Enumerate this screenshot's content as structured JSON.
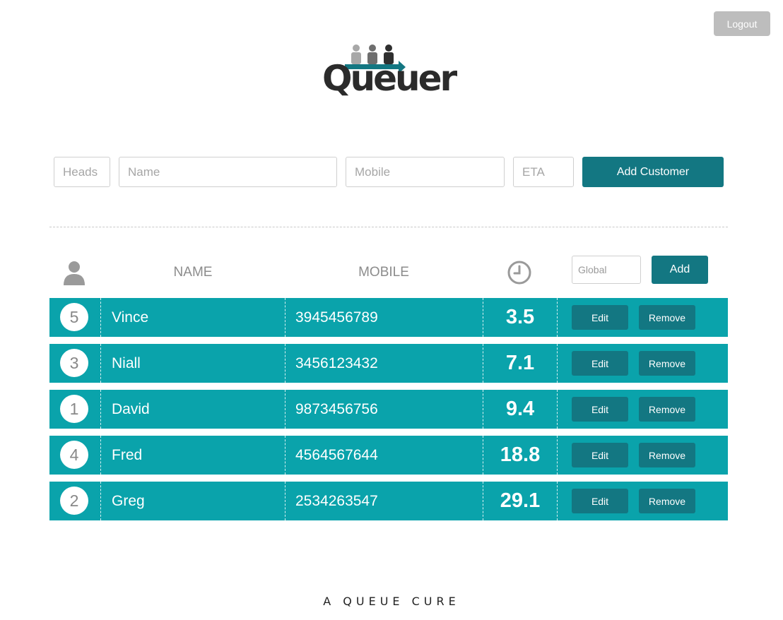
{
  "header": {
    "logout_label": "Logout"
  },
  "logo": {
    "text": "Queuer"
  },
  "form": {
    "heads_placeholder": "Heads",
    "name_placeholder": "Name",
    "mobile_placeholder": "Mobile",
    "eta_placeholder": "ETA",
    "add_customer_label": "Add Customer"
  },
  "table": {
    "headers": {
      "name": "NAME",
      "mobile": "MOBILE"
    },
    "global_placeholder": "Global",
    "global_add_label": "Add",
    "edit_label": "Edit",
    "remove_label": "Remove",
    "rows": [
      {
        "heads": "5",
        "name": "Vince",
        "mobile": "3945456789",
        "eta": "3.5"
      },
      {
        "heads": "3",
        "name": "Niall",
        "mobile": "3456123432",
        "eta": "7.1"
      },
      {
        "heads": "1",
        "name": "David",
        "mobile": "9873456756",
        "eta": "9.4"
      },
      {
        "heads": "4",
        "name": "Fred",
        "mobile": "4564567644",
        "eta": "18.8"
      },
      {
        "heads": "2",
        "name": "Greg",
        "mobile": "2534263547",
        "eta": "29.1"
      }
    ]
  },
  "footer": {
    "tagline": "A QUEUE CURE"
  },
  "colors": {
    "accent": "#137782",
    "row_bg": "#0aa3ab",
    "logout_bg": "#bdbdbd"
  },
  "icons": {
    "heads_header": "person-icon",
    "eta_header": "clock-icon"
  }
}
